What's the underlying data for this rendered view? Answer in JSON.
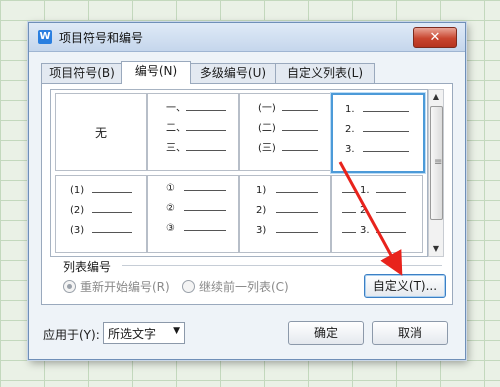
{
  "dialog": {
    "title": "项目符号和编号",
    "close_label": "✕",
    "tabs": [
      "项目符号(B)",
      "编号(N)",
      "多级编号(U)",
      "自定义列表(L)"
    ],
    "gallery": {
      "none_label": "无",
      "cell2": [
        "一、",
        "二、",
        "三、"
      ],
      "cell3": [
        "(一)",
        "(二)",
        "(三)"
      ],
      "cell4": [
        "1.",
        "2.",
        "3."
      ],
      "cell5": [
        "(1)",
        "(2)",
        "(3)"
      ],
      "cell6": [
        "①",
        "②",
        "③"
      ],
      "cell7": [
        "1)",
        "2)",
        "3)"
      ],
      "cell8": [
        "1.",
        "2.",
        "3."
      ]
    },
    "list_section_label": "列表编号",
    "radio_restart": "重新开始编号(R)",
    "radio_continue": "继续前一列表(C)",
    "customize_button": "自定义(T)...",
    "apply_to_label": "应用于(Y):",
    "apply_to_value": "所选文字",
    "ok_button": "确定",
    "cancel_button": "取消"
  }
}
